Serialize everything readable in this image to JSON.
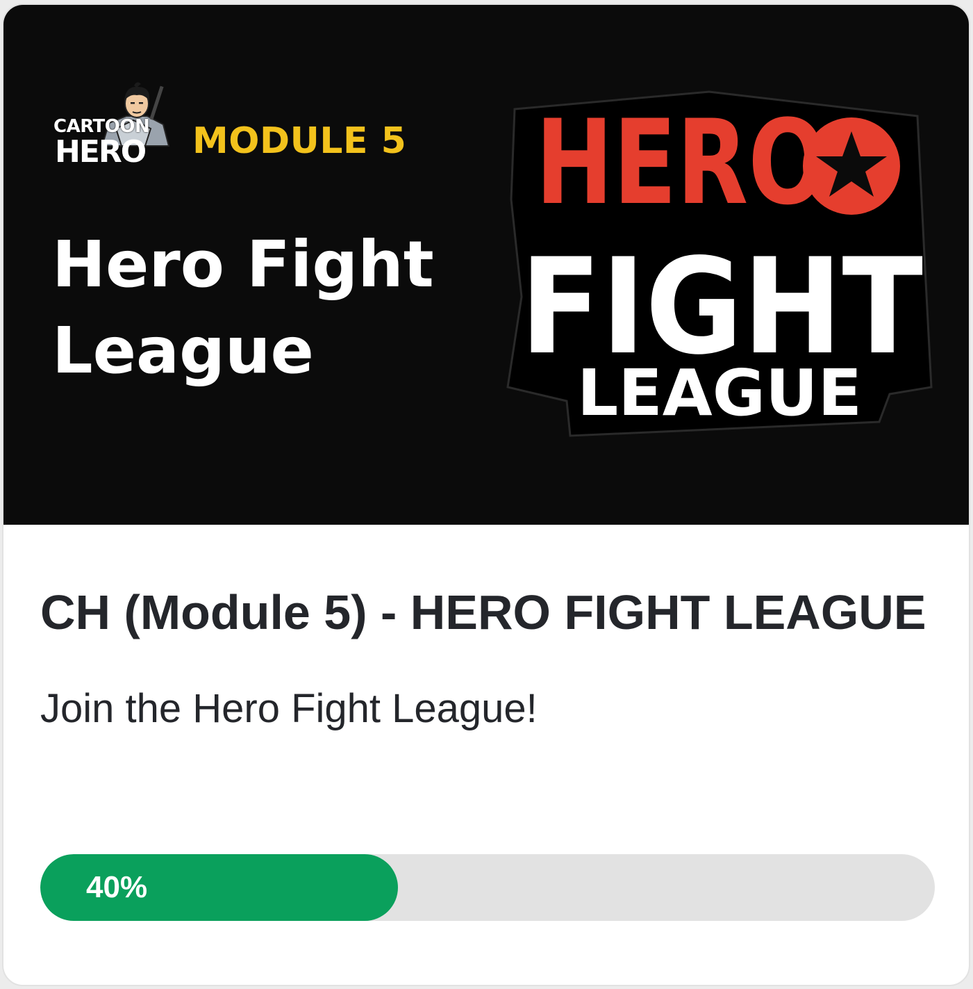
{
  "banner": {
    "brand_logo": {
      "line1": "CARTOON",
      "line2": "HERO",
      "icon": "ninja-mascot-icon"
    },
    "module_label": "MODULE 5",
    "title_line1": "Hero Fight",
    "title_line2": "League",
    "hfl_logo": {
      "line1": "HERO",
      "line2": "FIGHT",
      "line3": "LEAGUE",
      "icon": "star-badge-icon"
    }
  },
  "course": {
    "title": "CH (Module 5) - HERO FIGHT LEAGUE",
    "subtitle": "Join the Hero Fight League!",
    "progress_percent": 40,
    "progress_label": "40%"
  },
  "colors": {
    "banner_bg": "#0b0b0b",
    "module_yellow": "#f3c21c",
    "logo_red": "#e53e2e",
    "progress_green": "#0aa05c",
    "progress_track": "#e2e2e2",
    "text_dark": "#24262b"
  }
}
